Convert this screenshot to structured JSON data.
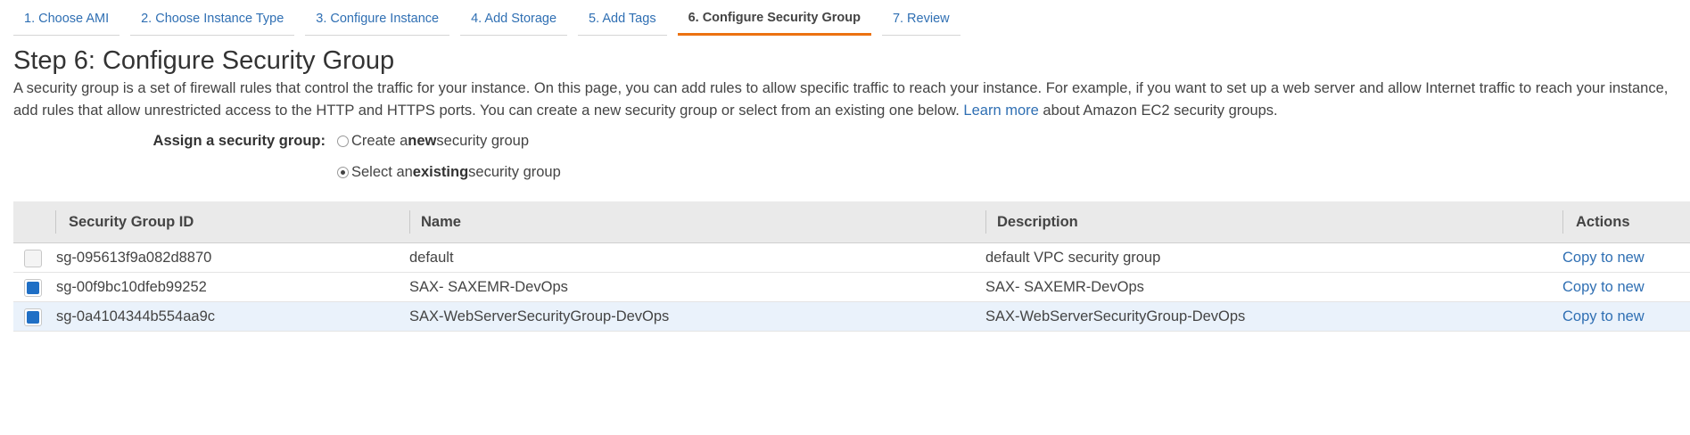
{
  "wizard_tabs": [
    {
      "label": "1. Choose AMI",
      "active": false
    },
    {
      "label": "2. Choose Instance Type",
      "active": false
    },
    {
      "label": "3. Configure Instance",
      "active": false
    },
    {
      "label": "4. Add Storage",
      "active": false
    },
    {
      "label": "5. Add Tags",
      "active": false
    },
    {
      "label": "6. Configure Security Group",
      "active": true
    },
    {
      "label": "7. Review",
      "active": false
    }
  ],
  "page_title": "Step 6: Configure Security Group",
  "intro": {
    "text_before_link": "A security group is a set of firewall rules that control the traffic for your instance. On this page, you can add rules to allow specific traffic to reach your instance. For example, if you want to set up a web server and allow Internet traffic to reach your instance, add rules that allow unrestricted access to the HTTP and HTTPS ports. You can create a new security group or select from an existing one below.",
    "link_text": "Learn more",
    "text_after_link": "about Amazon EC2 security groups."
  },
  "assign": {
    "label": "Assign a security group:",
    "options": [
      {
        "prefix": "Create a ",
        "emphasis": "new",
        "suffix": " security group",
        "selected": false
      },
      {
        "prefix": "Select an ",
        "emphasis": "existing",
        "suffix": " security group",
        "selected": true
      }
    ]
  },
  "table": {
    "columns": [
      "Security Group ID",
      "Name",
      "Description",
      "Actions"
    ],
    "rows": [
      {
        "id": "sg-095613f9a082d8870",
        "name": "default",
        "description": "default VPC security group",
        "action": "Copy to new",
        "checked": false
      },
      {
        "id": "sg-00f9bc10dfeb99252",
        "name": "SAX- SAXEMR-DevOps",
        "description": "SAX- SAXEMR-DevOps",
        "action": "Copy to new",
        "checked": true
      },
      {
        "id": "sg-0a4104344b554aa9c",
        "name": "SAX-WebServerSecurityGroup-DevOps",
        "description": "SAX-WebServerSecurityGroup-DevOps",
        "action": "Copy to new",
        "checked": true
      }
    ]
  },
  "colors": {
    "link": "#2f6fb3",
    "active_tab_underline": "#ec7211",
    "checkbox_checked": "#1f6fc5",
    "table_header_bg": "#eaeaea",
    "row_highlight_bg": "#eaf2fb"
  }
}
